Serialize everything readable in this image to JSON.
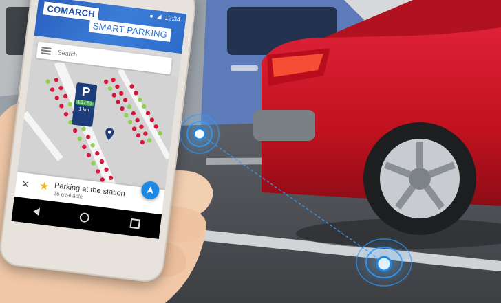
{
  "brand": {
    "logo_text": "COMARCH",
    "subtitle": "SMART PARKING"
  },
  "status_bar": {
    "time": "12:34",
    "icons": [
      "location-icon",
      "signal-icon"
    ]
  },
  "search": {
    "placeholder": "Search"
  },
  "parking_card": {
    "letter": "P",
    "availability": "16 / 83",
    "distance": "1 km"
  },
  "bottom_sheet": {
    "title": "Parking at the station",
    "subtitle": "16 available"
  },
  "colors": {
    "brand_blue": "#2a5fbf",
    "spot_free": "#8fd14f",
    "spot_taken": "#d6173a",
    "fab": "#1e88e5",
    "sensor_glow": "#2f9bff"
  },
  "nav_icons": [
    "back-icon",
    "home-icon",
    "recents-icon"
  ]
}
